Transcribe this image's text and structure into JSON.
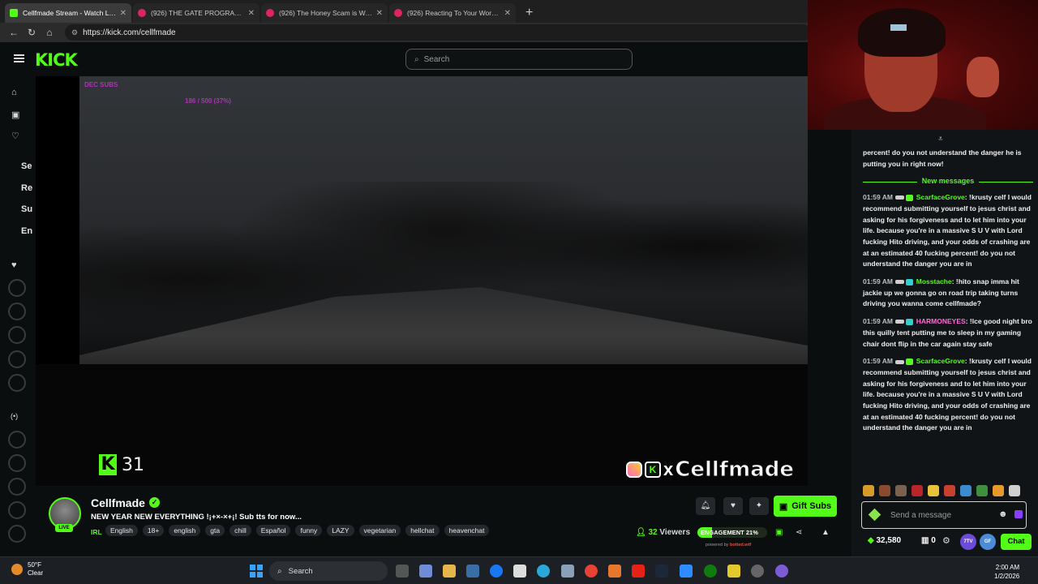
{
  "browser": {
    "tabs": [
      {
        "title": "Cellfmade Stream - Watch Live",
        "color": "#53fc18"
      },
      {
        "title": "(926) THE GATE PROGRAM: We're",
        "color": "#e0245e"
      },
      {
        "title": "(926) The Honey Scam is Worse Th",
        "color": "#e0245e"
      },
      {
        "title": "(926) Reacting To Your Worst Tech",
        "color": "#e0245e"
      }
    ],
    "new_tab": "+",
    "url": "https://kick.com/cellfmade"
  },
  "header": {
    "logo": "KICK",
    "search_placeholder": "Search"
  },
  "sidebar": {
    "labels": [
      "Se",
      "Re",
      "Su",
      "En"
    ],
    "avatar_colors": [
      "#3a6ea5",
      "#6aa84f",
      "#8e7cc3",
      "#c27ba0",
      "#b45f06",
      "#45818e",
      "#cc4125",
      "#a64d79",
      "#6d9eeb",
      "#93c47d"
    ]
  },
  "video": {
    "overlay_subs": "DEC SUBS",
    "overlay_goal": "186 / 500 (37%)",
    "kick_count": "31",
    "brand_x": "x",
    "brand_name": "Cellfmade"
  },
  "stream": {
    "name": "Cellfmade",
    "title": "NEW YEAR NEW EVERYTHING !¡+×-×+¡! Sub tts for now...",
    "category": "IRL",
    "tags": [
      "English",
      "18+",
      "english",
      "gta",
      "chill",
      "Español",
      "funny",
      "LAZY",
      "vegetarian",
      "hellchat",
      "heavenchat"
    ],
    "live_label": "LIVE",
    "gift_subs_label": "Gift Subs",
    "viewers_count": "32",
    "viewers_label": "Viewers",
    "engagement_label": "ENGAGEMENT",
    "engagement_value": "21%",
    "engagement_fraction": 0.21,
    "powered_prefix": "powered by",
    "powered_brand": "botted.wtf"
  },
  "chat": {
    "top_fragment": "percent! do you not understand the danger he is putting you in right now!",
    "new_messages_label": "New messages",
    "messages": [
      {
        "time": "01:59 AM",
        "user": "ScarfaceGrove",
        "user_class": "",
        "text": "!krusty celf I would recommend submitting yourself to jesus christ and asking for his forgiveness and to let him into your life. because you're in a massive S U V with Lord fucking Hito driving, and your odds of crashing are at an estimated 40 fucking percent! do you not understand the danger you are in"
      },
      {
        "time": "01:59 AM",
        "user": "Mosstache",
        "user_class": "",
        "text": "!hito      snap imma hit jackie up we gonna go on road trip taking turns driving you wanna come cellfmade?"
      },
      {
        "time": "01:59 AM",
        "user": "HARMONEYES",
        "user_class": "p",
        "text": "!lce good night bro this quilly tent putting me to sleep in my gaming chair dont flip in the car again stay safe"
      },
      {
        "time": "01:59 AM",
        "user": "ScarfaceGrove",
        "user_class": "",
        "text": "!krusty celf I would recommend submitting yourself to jesus christ and asking for his forgiveness and to let him into your life. because you're in a massive S U V with Lord fucking Hito driving, and your odds of crashing are at an estimated 40 fucking percent! do you not understand the danger you are in"
      }
    ],
    "input_placeholder": "Send a message",
    "points": "32,580",
    "zero_count": "0",
    "chat_button": "Chat",
    "ext_7tv": "7TV",
    "ext_gf": "GF"
  },
  "taskbar": {
    "temp": "50°F",
    "condition": "Clear",
    "search_label": "Search",
    "time": "2:00 AM",
    "date": "1/2/2026"
  }
}
